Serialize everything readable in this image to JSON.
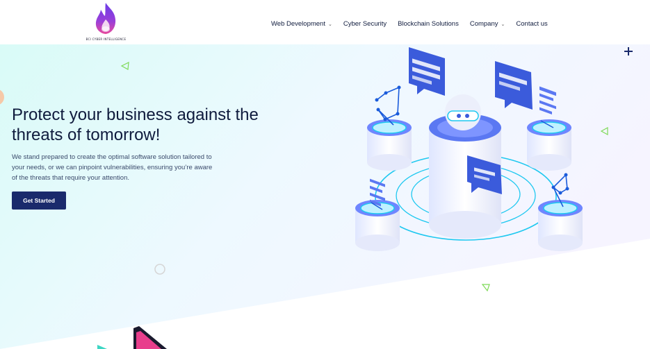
{
  "brand": {
    "logo_text": "BCI CYBER INTELLIGENCE",
    "colors": {
      "primary": "#1a2a6c",
      "flame_purple": "#7b3fe4",
      "flame_pink": "#e84a9c",
      "accent_blue": "#3b5bdb",
      "accent_cyan": "#1ec8f0",
      "hero_bg": "#e6fbfb"
    }
  },
  "nav": {
    "items": [
      {
        "label": "Web Development",
        "dropdown": true
      },
      {
        "label": "Cyber Security",
        "dropdown": false
      },
      {
        "label": "Blockchain Solutions",
        "dropdown": false
      },
      {
        "label": "Company",
        "dropdown": true
      },
      {
        "label": "Contact us",
        "dropdown": false
      }
    ],
    "chevron_icon": "chevron-down-icon"
  },
  "hero": {
    "title": "Protect your business against the threats of tomorrow!",
    "description": "We stand prepared to create the optimal software solution tailored to your needs, or we can pinpoint vulnerabilities, ensuring you’re aware of the threats that require your attention.",
    "cta_label": "Get Started"
  },
  "icons": {
    "plus": "plus-icon",
    "triangle": "triangle-outline-icon",
    "circle": "circle-outline-icon"
  }
}
